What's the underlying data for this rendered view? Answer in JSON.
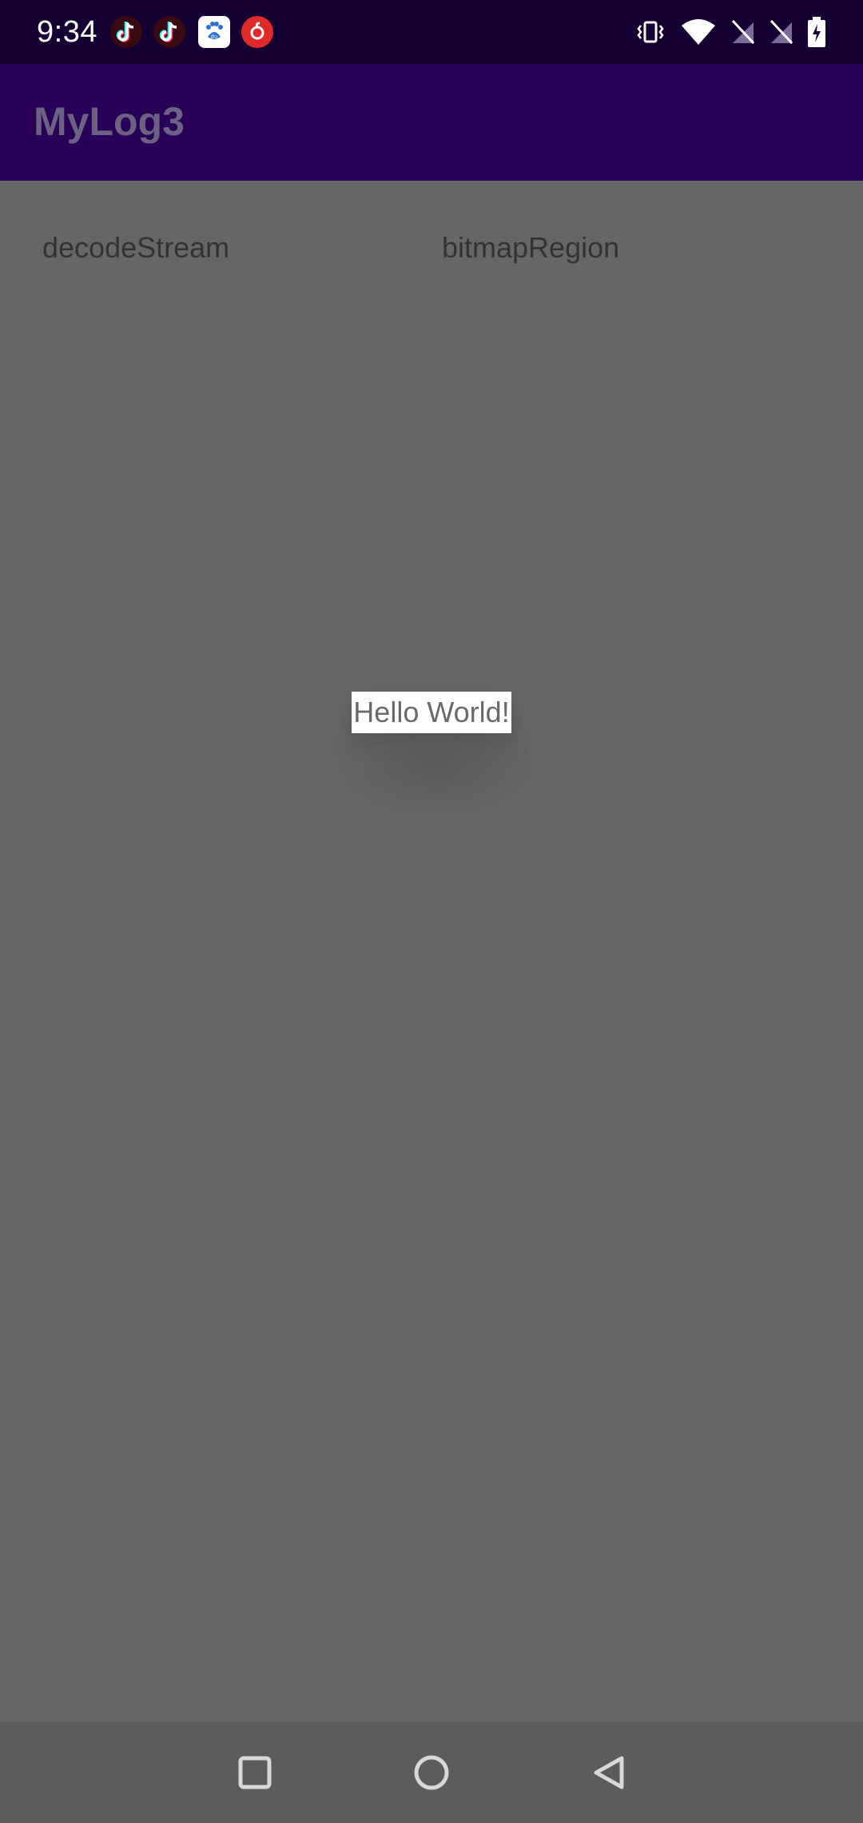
{
  "status_bar": {
    "time": "9:34",
    "notification_icons": [
      "tiktok-icon",
      "tiktok-icon",
      "baidu-icon",
      "netease-music-icon"
    ],
    "system_icons": [
      "vibrate-icon",
      "wifi-icon",
      "no-sim-icon",
      "no-sim-icon",
      "battery-charging-icon"
    ]
  },
  "app_bar": {
    "title": "MyLog3"
  },
  "content": {
    "buttons": [
      {
        "label": "decodeStream"
      },
      {
        "label": "bitmapRegion"
      }
    ],
    "toast": "Hello World!"
  },
  "nav_bar": {
    "buttons": [
      "recent-apps-icon",
      "home-icon",
      "back-icon"
    ]
  },
  "colors": {
    "status_bar_bg": "#140032",
    "app_bar_bg": "#280058",
    "content_bg": "#666666",
    "nav_bar_bg": "#5c5c5c"
  }
}
